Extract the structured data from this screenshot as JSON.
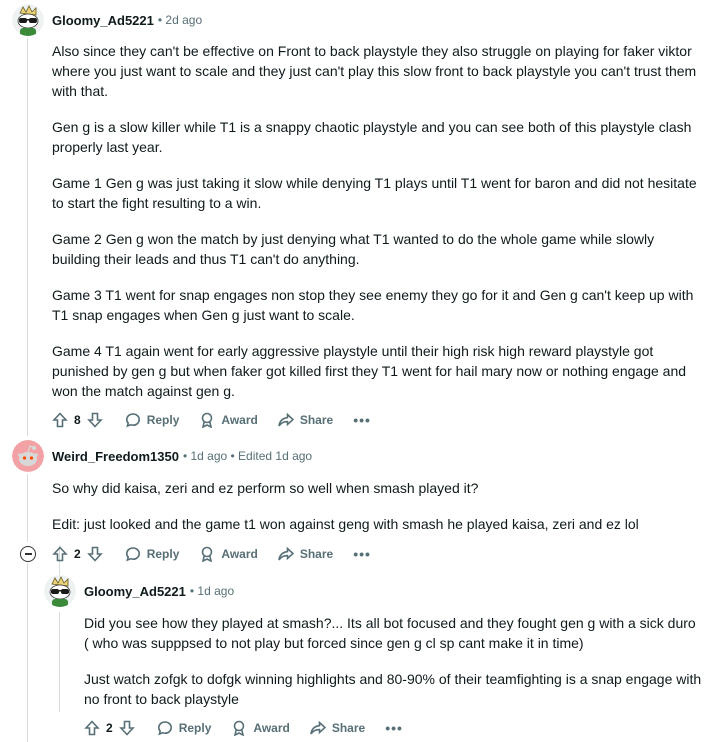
{
  "comments": [
    {
      "username": "Gloomy_Ad5221",
      "meta": "• 2d ago",
      "paragraphs": [
        "Also since they can't be effective on Front to back playstyle they also struggle on playing for faker viktor where you just want to scale and they just can't play this slow front to back playstyle you can't trust them with that.",
        "Gen g is a slow killer while T1 is a snappy chaotic playstyle and you can see both of this playstyle clash properly last year.",
        "Game 1 Gen g was just taking it slow while denying T1 plays until T1 went for baron and did not hesitate to start the fight resulting to a win.",
        "Game 2 Gen g won the match by just denying what T1 wanted to do the whole game while slowly building their leads and thus T1 can't do anything.",
        "Game 3 T1 went for snap engages non stop they see enemy they go for it and Gen g can't keep up with T1 snap engages when Gen g just want to scale.",
        "Game 4 T1 again went for early aggressive playstyle until their high risk high reward playstyle got punished by gen g but when faker got killed first they T1 went for hail mary now or nothing engage and won the match against gen g."
      ],
      "votes": "8",
      "reply": "Reply",
      "award": "Award",
      "share": "Share",
      "more": "•••"
    },
    {
      "username": "Weird_Freedom1350",
      "meta": "• 1d ago • Edited 1d ago",
      "paragraphs": [
        "So why did kaisa, zeri and ez perform so well when smash played it?",
        "Edit: just looked and the game t1 won against geng with smash he played kaisa, zeri and ez lol"
      ],
      "votes": "2",
      "reply": "Reply",
      "award": "Award",
      "share": "Share",
      "more": "•••"
    },
    {
      "username": "Gloomy_Ad5221",
      "meta": "• 1d ago",
      "paragraphs": [
        "Did you see how they played at smash?... Its all bot focused and they fought gen g with a sick duro ( who was supppsed to not play but forced since gen g cl sp cant make it in time)",
        "Just watch zofgk to dofgk winning highlights and 80-90% of their teamfighting is a snap engage with no front to back playstyle"
      ],
      "votes": "2",
      "reply": "Reply",
      "award": "Award",
      "share": "Share",
      "more": "•••"
    }
  ],
  "colors": {
    "text": "#0f1a1c",
    "muted": "#576f76",
    "thread": "#d6dde0",
    "avatar1_bg": "#eef2f3",
    "avatar2_bg": "#f2a2a4"
  }
}
